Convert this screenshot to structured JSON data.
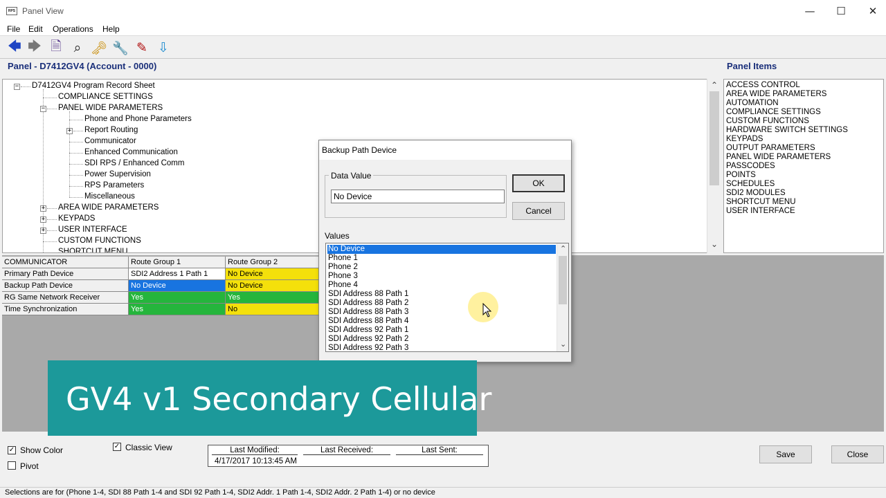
{
  "window": {
    "app_icon_text": "RPS",
    "title": "Panel View",
    "minimize_glyph": "—",
    "maximize_glyph": "☐",
    "close_glyph": "✕"
  },
  "menu": [
    "File",
    "Edit",
    "Operations",
    "Help"
  ],
  "toolbar": {
    "icons": [
      "back-arrow-icon",
      "forward-arrow-icon",
      "search-document-icon",
      "binoculars-icon",
      "key-document-icon",
      "wrench-icon",
      "edit-document-icon",
      "send-device-icon"
    ],
    "glyphs": [
      "🡄",
      "🡆",
      "🗎",
      "⌕",
      "🗝",
      "🔧",
      "✎",
      "⇩"
    ],
    "colors": [
      "#1e45c4",
      "#777777",
      "#5a3b8e",
      "#222222",
      "#c88a00",
      "#444444",
      "#b01010",
      "#1a8ad0"
    ]
  },
  "panel": {
    "title": "Panel - D7412GV4 (Account - 0000)",
    "items_title": "Panel Items"
  },
  "tree": {
    "root": "D7412GV4 Program Record Sheet",
    "compliance": "COMPLIANCE SETTINGS",
    "panel_wide": "PANEL WIDE PARAMETERS",
    "phone": "Phone and Phone Parameters",
    "report_routing": "Report Routing",
    "communicator": "Communicator",
    "enhanced": "Enhanced Communication",
    "sdi_rps": "SDI RPS / Enhanced Comm",
    "power": "Power Supervision",
    "rps_params": "RPS Parameters",
    "misc": "Miscellaneous",
    "area_wide": "AREA WIDE PARAMETERS",
    "keypads": "KEYPADS",
    "user_interface": "USER INTERFACE",
    "custom": "CUSTOM FUNCTIONS",
    "shortcut": "SHORTCUT MENU"
  },
  "panel_items": [
    "ACCESS CONTROL",
    "AREA WIDE PARAMETERS",
    "AUTOMATION",
    "COMPLIANCE SETTINGS",
    "CUSTOM FUNCTIONS",
    "HARDWARE SWITCH SETTINGS",
    "KEYPADS",
    "OUTPUT PARAMETERS",
    "PANEL WIDE PARAMETERS",
    "PASSCODES",
    "POINTS",
    "SCHEDULES",
    "SDI2 MODULES",
    "SHORTCUT MENU",
    "USER INTERFACE"
  ],
  "grid": {
    "header": [
      "COMMUNICATOR",
      "Route Group 1",
      "Route Group 2"
    ],
    "rows": [
      {
        "label": "Primary Path Device",
        "rg1": "SDI2 Address 1 Path 1",
        "rg2": "No Device"
      },
      {
        "label": "Backup Path Device",
        "rg1": "No Device",
        "rg2": "No Device"
      },
      {
        "label": "RG Same Network Receiver",
        "rg1": "Yes",
        "rg2": "Yes"
      },
      {
        "label": "Time Synchronization",
        "rg1": "Yes",
        "rg2": "No"
      }
    ]
  },
  "dialog": {
    "title": "Backup Path Device",
    "data_value_label": "Data Value",
    "data_value": "No Device",
    "ok": "OK",
    "cancel": "Cancel",
    "values_label": "Values",
    "values": [
      "No Device",
      "Phone 1",
      "Phone 2",
      "Phone 3",
      "Phone 4",
      "SDI Address 88 Path 1",
      "SDI Address 88 Path 2",
      "SDI Address 88 Path 3",
      "SDI Address 88 Path 4",
      "SDI Address 92 Path 1",
      "SDI Address 92 Path 2",
      "SDI Address 92 Path 3"
    ],
    "selected_index": 0
  },
  "banner": "GV4 v1 Secondary Cellular",
  "options": {
    "show_color": "Show Color",
    "pivot": "Pivot",
    "classic_view": "Classic View",
    "check_glyph": "✓"
  },
  "modified": {
    "last_modified_label": "Last Modified:",
    "last_received_label": "Last Received:",
    "last_sent_label": "Last Sent:",
    "last_modified_value": "4/17/2017 10:13:45 AM"
  },
  "buttons": {
    "save": "Save",
    "close": "Close"
  },
  "scroll_glyphs": {
    "up": "⌃",
    "down": "⌄"
  },
  "status_text": "Selections are for (Phone 1-4, SDI 88 Path 1-4 and SDI 92 Path 1-4, SDI2 Addr. 1 Path 1-4, SDI2 Addr. 2 Path 1-4) or no device"
}
